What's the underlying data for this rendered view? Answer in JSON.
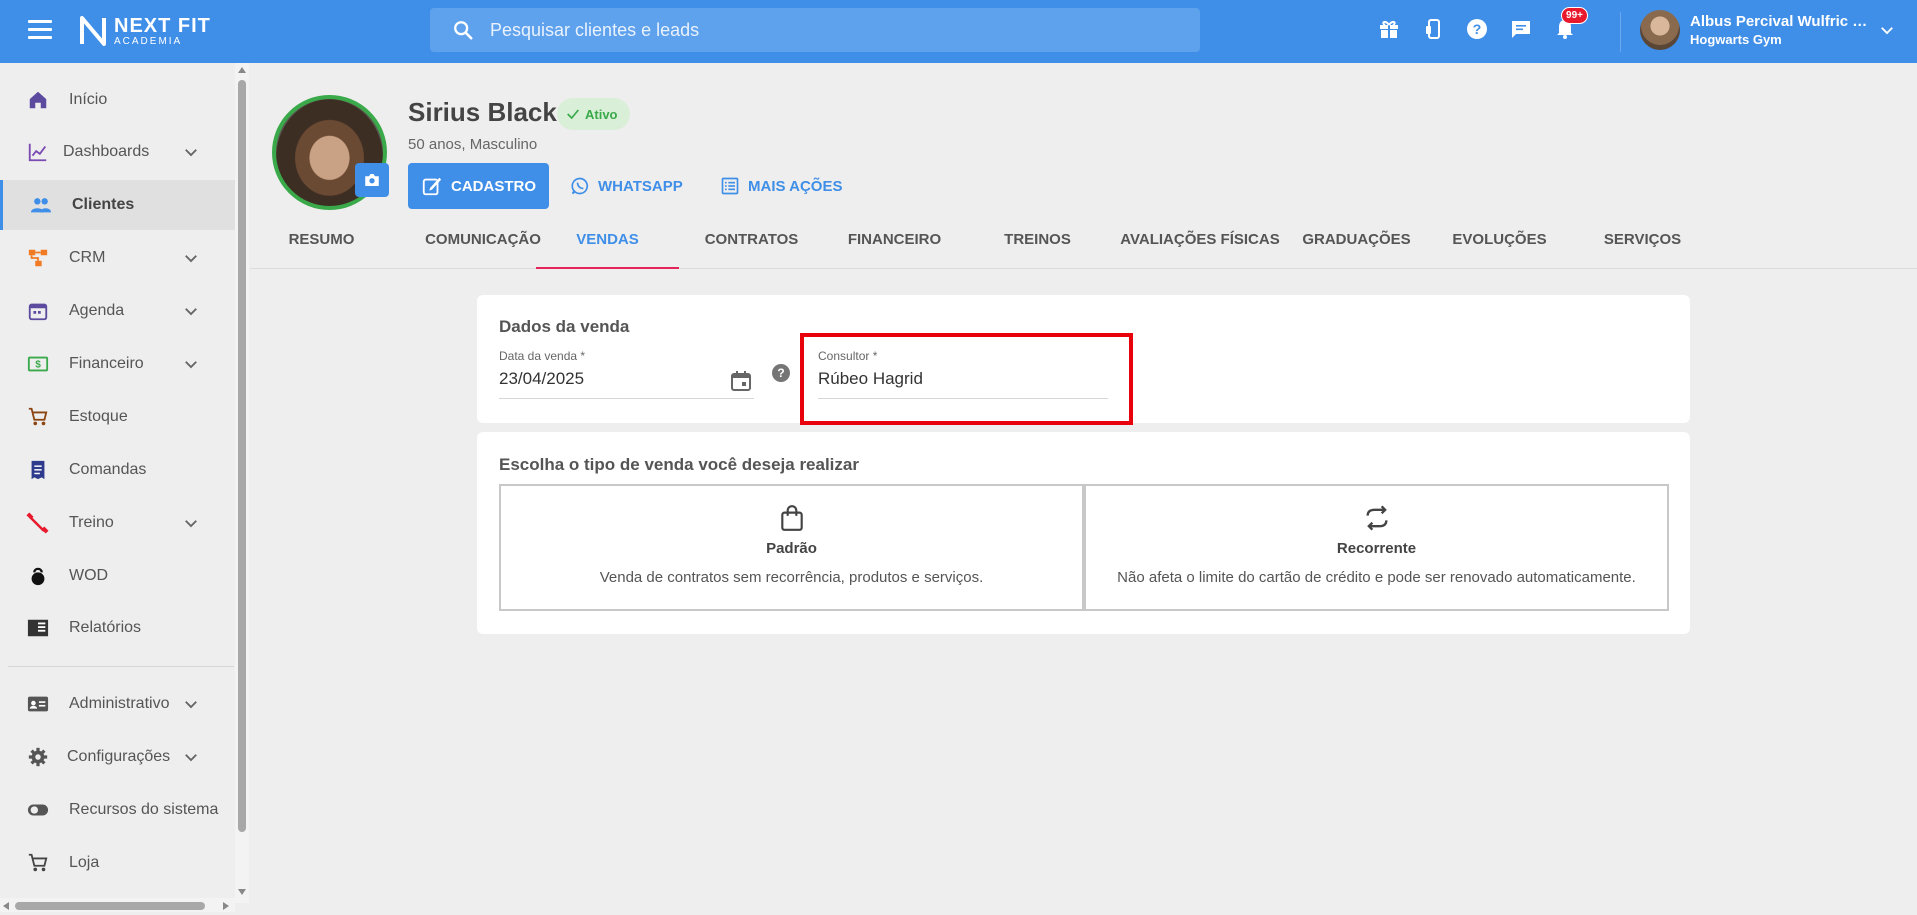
{
  "header": {
    "brand_name": "NEXT FIT",
    "brand_sub": "ACADEMIA",
    "search_placeholder": "Pesquisar clientes e leads",
    "notifications_badge": "99+",
    "user_name": "Albus Percival Wulfric B...",
    "user_gym": "Hogwarts Gym",
    "accent_color": "#3f8ee8"
  },
  "sidebar": {
    "items": [
      {
        "label": "Início",
        "icon": "home-icon"
      },
      {
        "label": "Dashboards",
        "icon": "chart-line-icon",
        "expandable": true
      },
      {
        "label": "Clientes",
        "icon": "people-icon",
        "active": true
      },
      {
        "label": "CRM",
        "icon": "crm-icon",
        "expandable": true
      },
      {
        "label": "Agenda",
        "icon": "calendar-icon",
        "expandable": true
      },
      {
        "label": "Financeiro",
        "icon": "money-icon",
        "expandable": true
      },
      {
        "label": "Estoque",
        "icon": "cart-icon"
      },
      {
        "label": "Comandas",
        "icon": "receipt-icon"
      },
      {
        "label": "Treino",
        "icon": "dumbbell-icon",
        "expandable": true
      },
      {
        "label": "WOD",
        "icon": "kettlebell-icon"
      },
      {
        "label": "Relatórios",
        "icon": "report-icon"
      },
      {
        "label": "Administrativo",
        "icon": "id-card-icon",
        "expandable": true
      },
      {
        "label": "Configurações",
        "icon": "gear-icon",
        "expandable": true
      },
      {
        "label": "Recursos do sistema",
        "icon": "toggle-icon"
      },
      {
        "label": "Loja",
        "icon": "cart-icon"
      }
    ]
  },
  "profile": {
    "name": "Sirius Black",
    "status": "Ativo",
    "subtitle": "50 anos, Masculino",
    "btn_cadastro": "CADASTRO",
    "btn_whatsapp": "WHATSAPP",
    "btn_mais_acoes": "MAIS AÇÕES"
  },
  "tabs": [
    {
      "label": "RESUMO"
    },
    {
      "label": "COMUNICAÇÃO"
    },
    {
      "label": "VENDAS",
      "active": true
    },
    {
      "label": "CONTRATOS"
    },
    {
      "label": "FINANCEIRO"
    },
    {
      "label": "TREINOS"
    },
    {
      "label": "AVALIAÇÕES FÍSICAS"
    },
    {
      "label": "GRADUAÇÕES"
    },
    {
      "label": "EVOLUÇÕES"
    },
    {
      "label": "SERVIÇOS"
    }
  ],
  "sale_data": {
    "title": "Dados da venda",
    "date_label": "Data da venda *",
    "date_value": "23/04/2025",
    "consultant_label": "Consultor *",
    "consultant_value": "Rúbeo Hagrid"
  },
  "sale_type": {
    "title": "Escolha o tipo de venda você deseja realizar",
    "options": [
      {
        "title": "Padrão",
        "desc": "Venda de contratos sem recorrência, produtos e serviços.",
        "icon": "shopping-bag-icon"
      },
      {
        "title": "Recorrente",
        "desc": "Não afeta o limite do cartão de crédito e pode ser renovado automaticamente.",
        "icon": "repeat-icon"
      }
    ]
  }
}
